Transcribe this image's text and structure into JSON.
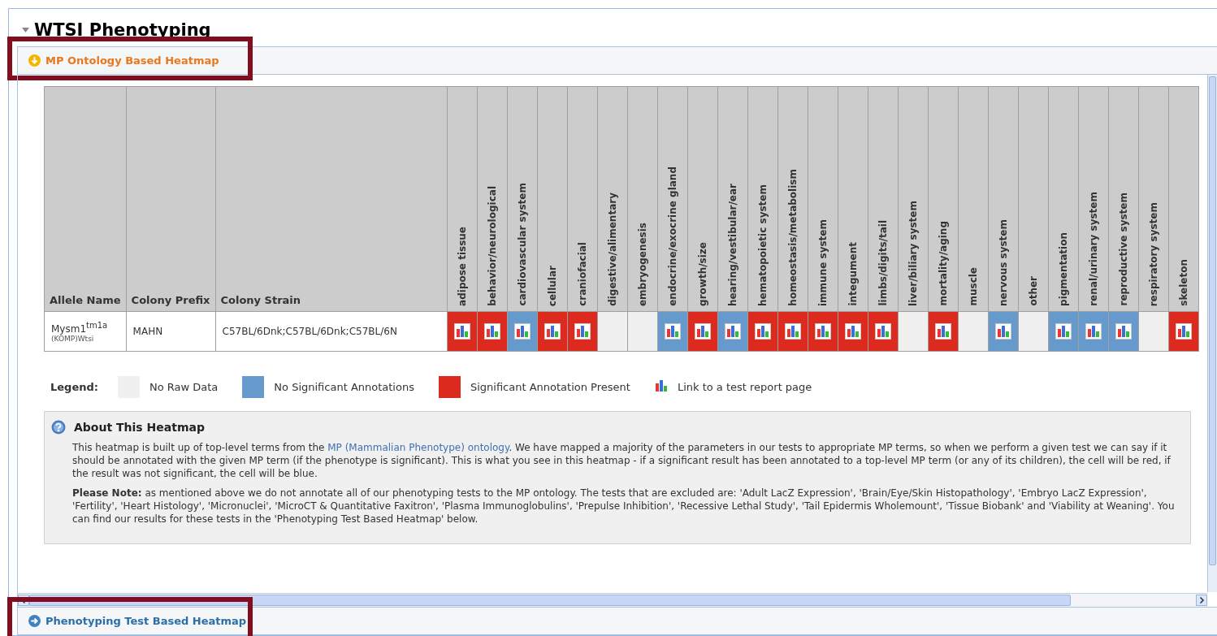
{
  "title": "WTSI Phenotyping",
  "sections": [
    {
      "label": "MP Ontology Based Heatmap",
      "expanded": true,
      "highlighted": true
    },
    {
      "label": "Phenotyping Test Based Heatmap",
      "expanded": false,
      "highlighted": true
    }
  ],
  "table": {
    "columns": [
      "Allele Name",
      "Colony Prefix",
      "Colony Strain"
    ],
    "phenotypes": [
      "adipose tissue",
      "behavior/neurological",
      "cardiovascular system",
      "cellular",
      "craniofacial",
      "digestive/alimentary",
      "embryogenesis",
      "endocrine/exocrine gland",
      "growth/size",
      "hearing/vestibular/ear",
      "hematopoietic system",
      "homeostasis/metabolism",
      "immune system",
      "integument",
      "limbs/digits/tail",
      "liver/biliary system",
      "mortality/aging",
      "muscle",
      "nervous system",
      "other",
      "pigmentation",
      "renal/urinary system",
      "reproductive system",
      "respiratory system",
      "skeleton"
    ],
    "rows": [
      {
        "allele": "Mysm1$^{tm1a}$",
        "allele_sub": "(KOMP)Wtsi",
        "prefix": "MAHN",
        "strain": "C57BL/6Dnk;C57BL/6Dnk;C57BL/6N",
        "cells": [
          {
            "has_data": true,
            "significant": true
          },
          {
            "has_data": true,
            "significant": true
          },
          {
            "has_data": true,
            "significant": false
          },
          {
            "has_data": true,
            "significant": true
          },
          {
            "has_data": true,
            "significant": true
          },
          {
            "has_data": false
          },
          {
            "has_data": false
          },
          {
            "has_data": true,
            "significant": false
          },
          {
            "has_data": true,
            "significant": true
          },
          {
            "has_data": true,
            "significant": false
          },
          {
            "has_data": true,
            "significant": true
          },
          {
            "has_data": true,
            "significant": true
          },
          {
            "has_data": true,
            "significant": true
          },
          {
            "has_data": true,
            "significant": true
          },
          {
            "has_data": true,
            "significant": true
          },
          {
            "has_data": false
          },
          {
            "has_data": true,
            "significant": true
          },
          {
            "has_data": false
          },
          {
            "has_data": true,
            "significant": false
          },
          {
            "has_data": false
          },
          {
            "has_data": true,
            "significant": false
          },
          {
            "has_data": true,
            "significant": false
          },
          {
            "has_data": true,
            "significant": false
          },
          {
            "has_data": false
          },
          {
            "has_data": true,
            "significant": true
          }
        ]
      }
    ]
  },
  "legend": {
    "title": "Legend:",
    "items": [
      {
        "kind": "swatch",
        "color": "#f0f0f0",
        "label": "No Raw Data"
      },
      {
        "kind": "swatch",
        "color": "#6699cc",
        "label": "No Significant Annotations"
      },
      {
        "kind": "swatch",
        "color": "#dd2a1f",
        "label": "Significant Annotation Present"
      },
      {
        "kind": "link",
        "label": "Link to a test report page"
      }
    ]
  },
  "about": {
    "title": "About This Heatmap",
    "intro_before": "This heatmap is built up of top-level terms from the ",
    "intro_link": "MP (Mammalian Phenotype) ontology",
    "intro_after": ". We have mapped a majority of the parameters in our tests to appropriate MP terms, so when we perform a given test we can say if it should be annotated with the given MP term (if the phenotype is significant). This is what you see in this heatmap - if a significant result has been annotated to a top-level MP term (or any of its children), the cell will be red, if the result was not significant, the cell will be blue.",
    "note": "**Please Note:** as mentioned above we do not annotate all of our phenotyping tests to the MP ontology. The tests that are excluded are: 'Adult LacZ Expression', 'Brain/Eye/Skin Histopathology', 'Embryo LacZ Expression', 'Fertility', 'Heart Histology', 'Micronuclei', 'MicroCT & Quantitative Faxitron', 'Plasma Immunoglobulins', 'Prepulse Inhibition', 'Recessive Lethal Study', 'Tail Epidermis Wholemount', 'Tissue Biobank' and 'Viability at Weaning'. You can find our results for these tests in the 'Phenotyping Test Based Heatmap' below."
  }
}
